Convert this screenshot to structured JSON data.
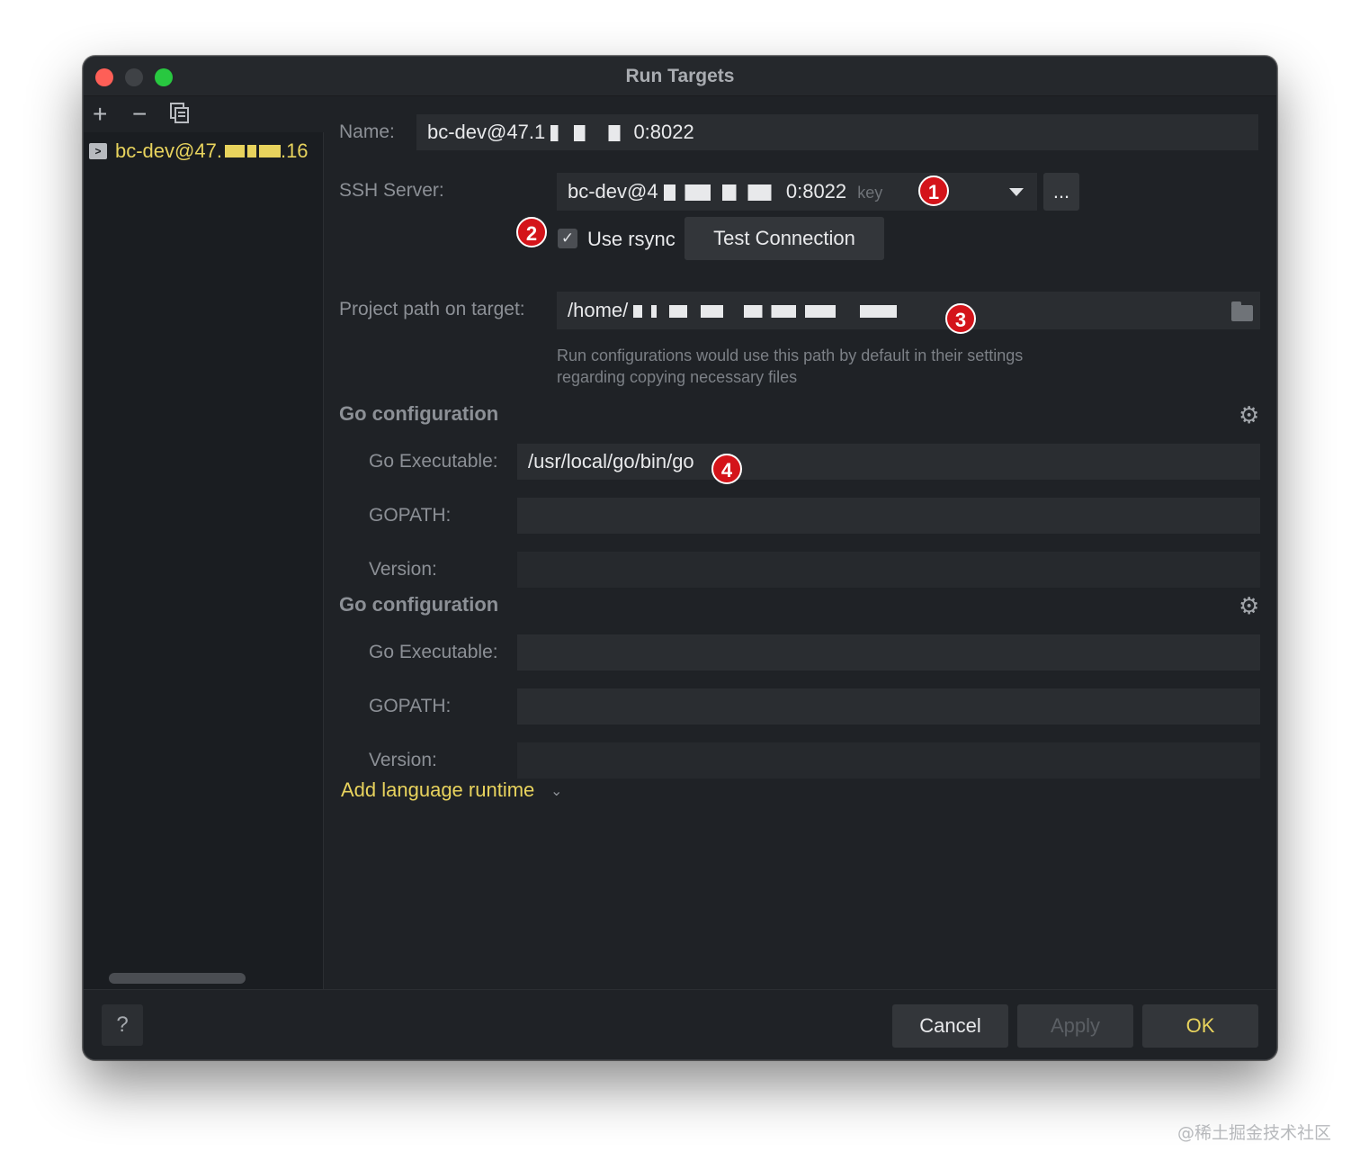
{
  "window": {
    "title": "Run Targets"
  },
  "sidebar": {
    "toolbar": {
      "add": "+",
      "remove": "−",
      "copy": "⧉"
    },
    "items": [
      {
        "label": "bc-dev@47.",
        "suffix": ".16"
      }
    ]
  },
  "form": {
    "name_label": "Name:",
    "name_value": "bc-dev@47.1",
    "name_value_tail": "0:8022",
    "ssh_label": "SSH Server:",
    "ssh_value": "bc-dev@4",
    "ssh_value_tail": "0:8022",
    "ssh_key_hint": "key",
    "more_button": "...",
    "use_rsync_label": "Use rsync",
    "test_connection_label": "Test Connection",
    "project_path_label": "Project path on target:",
    "project_path_value": "/home/",
    "project_path_hint_line1": "Run configurations would use this path by default in their settings",
    "project_path_hint_line2": "regarding copying necessary files"
  },
  "go_configs": [
    {
      "title": "Go configuration",
      "executable_label": "Go Executable:",
      "executable_value": "/usr/local/go/bin/go",
      "gopath_label": "GOPATH:",
      "gopath_value": "",
      "version_label": "Version:",
      "version_value": ""
    },
    {
      "title": "Go configuration",
      "executable_label": "Go Executable:",
      "executable_value": "",
      "gopath_label": "GOPATH:",
      "gopath_value": "",
      "version_label": "Version:",
      "version_value": ""
    }
  ],
  "add_runtime_label": "Add language runtime",
  "footer": {
    "help": "?",
    "cancel": "Cancel",
    "apply": "Apply",
    "ok": "OK"
  },
  "annotations": [
    "1",
    "2",
    "3",
    "4"
  ],
  "watermark": "@稀土掘金技术社区",
  "colors": {
    "accent_yellow": "#e8d35d",
    "badge_red": "#d4141a",
    "background": "#1f2226"
  }
}
